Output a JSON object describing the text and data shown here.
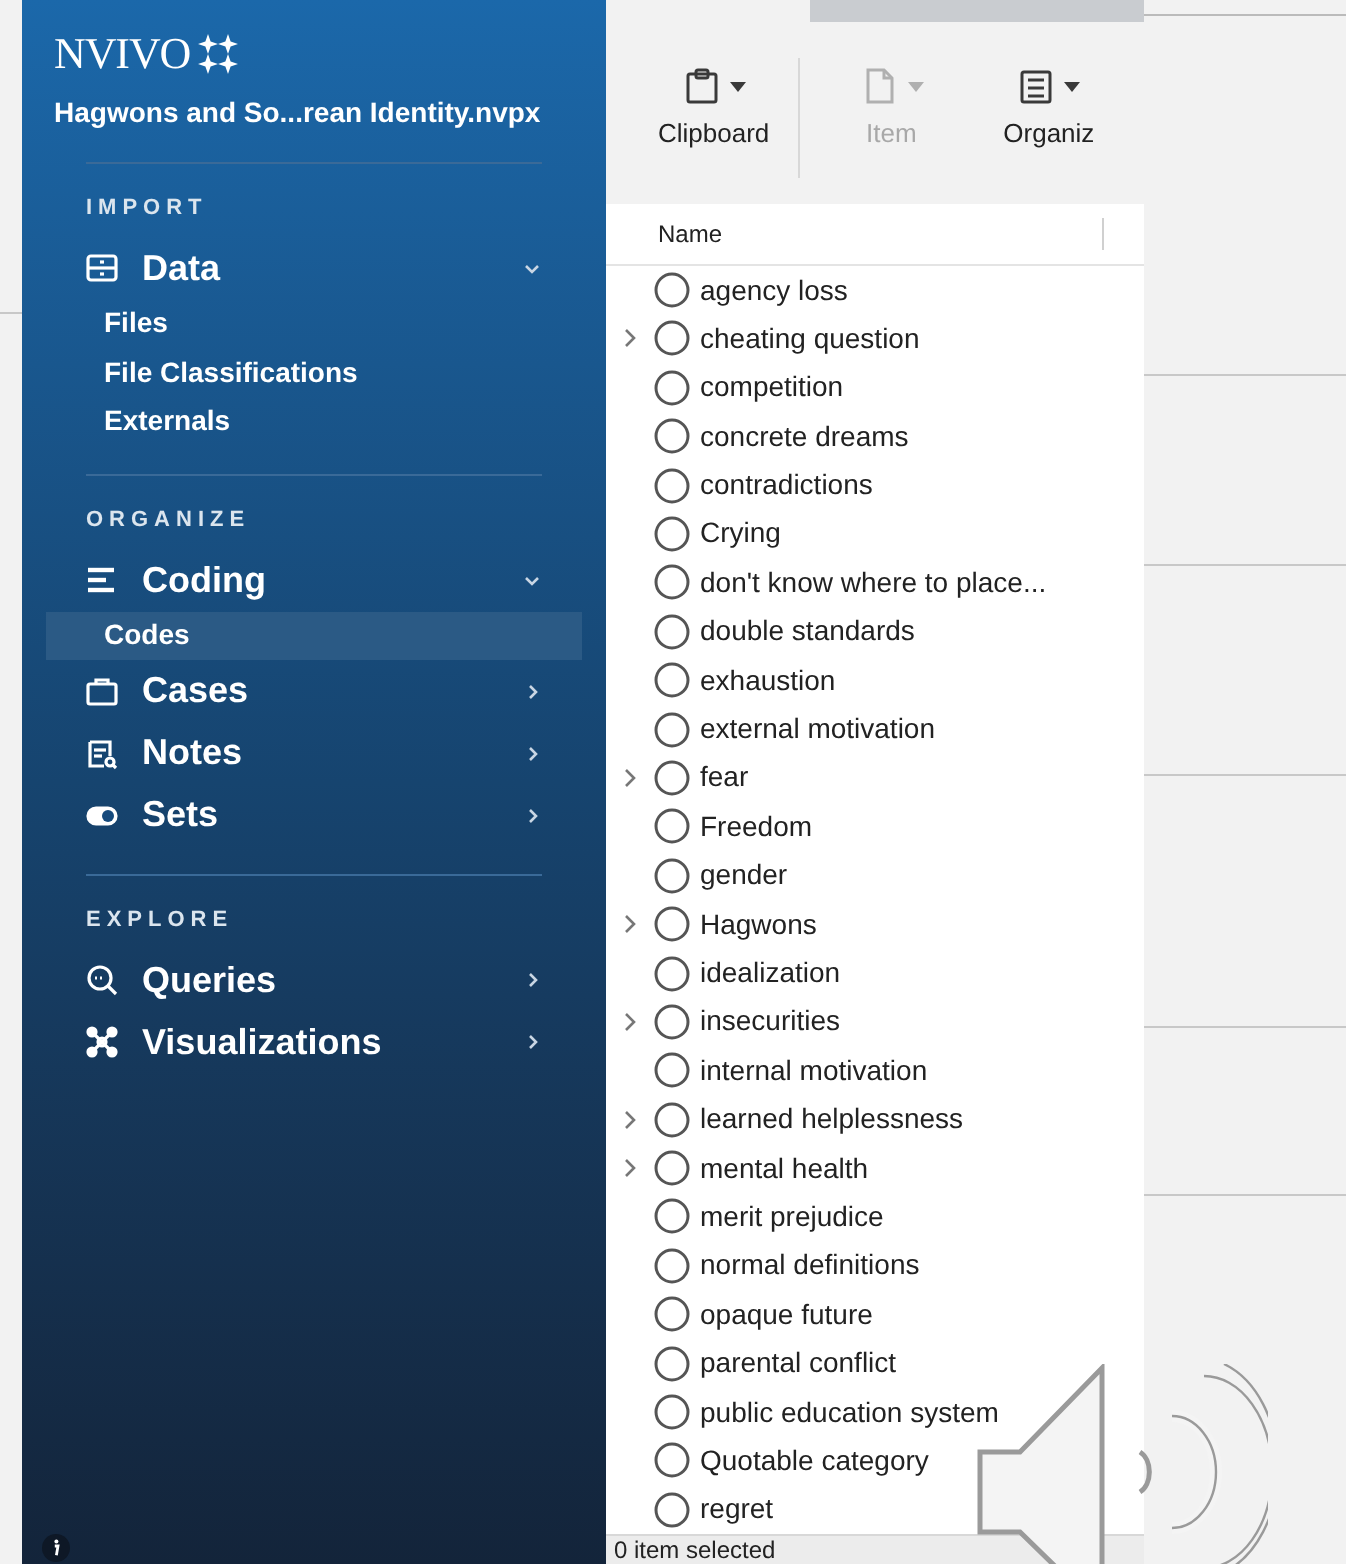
{
  "app": {
    "logo": "NVIVO",
    "project": "Hagwons and So...rean Identity.nvpx"
  },
  "sidebar": {
    "sections": [
      {
        "title": "IMPORT",
        "items": [
          {
            "label": "Data",
            "kind": "drawer",
            "expanded": true,
            "children": [
              {
                "label": "Files",
                "selected": false
              },
              {
                "label": "File Classifications",
                "selected": false
              },
              {
                "label": "Externals",
                "selected": false
              }
            ]
          }
        ]
      },
      {
        "title": "ORGANIZE",
        "items": [
          {
            "label": "Coding",
            "kind": "lines",
            "expanded": true,
            "children": [
              {
                "label": "Codes",
                "selected": true
              }
            ]
          },
          {
            "label": "Cases",
            "kind": "case",
            "expanded": false
          },
          {
            "label": "Notes",
            "kind": "notes",
            "expanded": false
          },
          {
            "label": "Sets",
            "kind": "toggle",
            "expanded": false
          }
        ]
      },
      {
        "title": "EXPLORE",
        "items": [
          {
            "label": "Queries",
            "kind": "search",
            "expanded": false
          },
          {
            "label": "Visualizations",
            "kind": "network",
            "expanded": false
          }
        ]
      }
    ]
  },
  "toolbar": [
    {
      "label": "Clipboard",
      "kind": "clipboard",
      "disabled": false
    },
    {
      "label": "Item",
      "kind": "page",
      "disabled": true
    },
    {
      "label": "Organiz",
      "kind": "list",
      "disabled": false
    }
  ],
  "table": {
    "columns": [
      "Name"
    ],
    "rows": [
      {
        "name": "agency loss",
        "has_children": false
      },
      {
        "name": "cheating question",
        "has_children": true
      },
      {
        "name": "competition",
        "has_children": false
      },
      {
        "name": "concrete dreams",
        "has_children": false
      },
      {
        "name": "contradictions",
        "has_children": false
      },
      {
        "name": "Crying",
        "has_children": false
      },
      {
        "name": "don't know where to place...",
        "has_children": false
      },
      {
        "name": "double standards",
        "has_children": false
      },
      {
        "name": "exhaustion",
        "has_children": false
      },
      {
        "name": "external motivation",
        "has_children": false
      },
      {
        "name": "fear",
        "has_children": true
      },
      {
        "name": "Freedom",
        "has_children": false
      },
      {
        "name": "gender",
        "has_children": false
      },
      {
        "name": "Hagwons",
        "has_children": true
      },
      {
        "name": "idealization",
        "has_children": false
      },
      {
        "name": "insecurities",
        "has_children": true
      },
      {
        "name": "internal motivation",
        "has_children": false
      },
      {
        "name": "learned helplessness",
        "has_children": true
      },
      {
        "name": "mental health",
        "has_children": true
      },
      {
        "name": "merit prejudice",
        "has_children": false
      },
      {
        "name": "normal definitions",
        "has_children": false
      },
      {
        "name": "opaque future",
        "has_children": false
      },
      {
        "name": "parental conflict",
        "has_children": false
      },
      {
        "name": "public education system",
        "has_children": false
      },
      {
        "name": "Quotable category",
        "has_children": false
      },
      {
        "name": "regret",
        "has_children": false
      }
    ]
  },
  "status_bar": "0 item selected"
}
